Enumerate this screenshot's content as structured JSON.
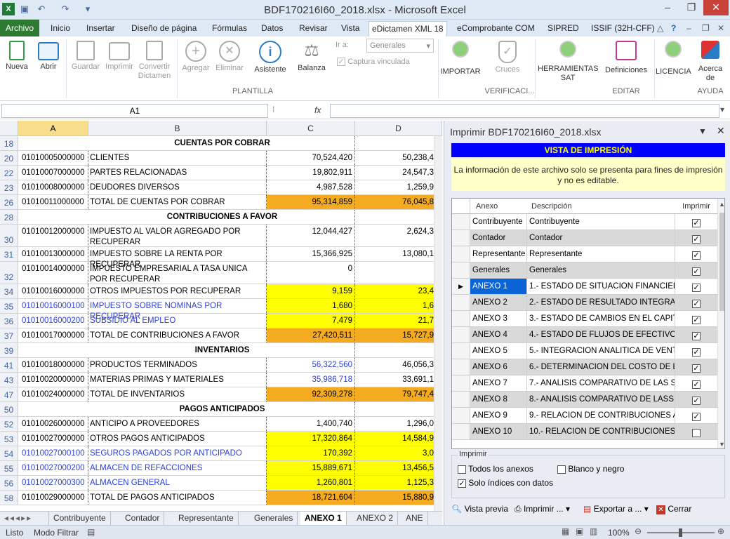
{
  "window": {
    "title": "BDF170216I60_2018.xlsx - Microsoft Excel"
  },
  "tabs": [
    "Archivo",
    "Inicio",
    "Insertar",
    "Diseño de página",
    "Fórmulas",
    "Datos",
    "Revisar",
    "Vista",
    "eDictamen XML 18",
    "eComprobante COM",
    "SIPRED",
    "ISSIF (32H-CFF)"
  ],
  "ribbon": {
    "buttons": [
      "Nueva",
      "Abrir",
      "Guardar",
      "Imprimir",
      "Convertir Dictamen",
      "Agregar",
      "Eliminar",
      "Asistente",
      "Balanza",
      "IMPORTAR",
      "Cruces",
      "HERRAMIENTAS SAT",
      "Definiciones",
      "LICENCIA",
      "Acerca de"
    ],
    "ir_a_label": "Ir a:",
    "ir_a_value": "Generales",
    "captura_label": "Captura vinculada",
    "groups": [
      "PLANTILLA",
      "VERIFICACI...",
      "EDITAR",
      "AYUDA"
    ]
  },
  "formula_bar": {
    "namebox": "A1",
    "fx": "fx"
  },
  "columns": [
    "A",
    "B",
    "C",
    "D"
  ],
  "rows": [
    {
      "n": "18",
      "type": "section",
      "b": "CUENTAS POR COBRAR"
    },
    {
      "n": "20",
      "a": "01010005000000",
      "b": "CLIENTES",
      "c": "70,524,420",
      "d": "50,238,4"
    },
    {
      "n": "22",
      "a": "01010007000000",
      "b": "PARTES RELACIONADAS",
      "c": "19,802,911",
      "d": "24,547,3"
    },
    {
      "n": "23",
      "a": "01010008000000",
      "b": "DEUDORES DIVERSOS",
      "c": "4,987,528",
      "d": "1,259,9"
    },
    {
      "n": "26",
      "a": "01010011000000",
      "b": "TOTAL DE CUENTAS POR COBRAR",
      "c": "95,314,859",
      "d": "76,045,8",
      "fill": "org"
    },
    {
      "n": "28",
      "type": "section",
      "b": "CONTRIBUCIONES A FAVOR"
    },
    {
      "n": "30",
      "a": "01010012000000",
      "b": "IMPUESTO AL VALOR AGREGADO POR RECUPERAR",
      "c": "12,044,427",
      "d": "2,624,3",
      "tall": true
    },
    {
      "n": "31",
      "a": "01010013000000",
      "b": "IMPUESTO SOBRE LA RENTA POR RECUPERAR",
      "c": "15,366,925",
      "d": "13,080,1"
    },
    {
      "n": "32",
      "a": "01010014000000",
      "b": "IMPUESTO EMPRESARIAL A TASA UNICA POR RECUPERAR",
      "c": "0",
      "d": "",
      "tall": true
    },
    {
      "n": "34",
      "a": "01010016000000",
      "b": "OTROS IMPUESTOS POR RECUPERAR",
      "c": "9,159",
      "d": "23,4",
      "fill": "yel"
    },
    {
      "n": "35",
      "a": "01010016000100",
      "b": "IMPUESTO SOBRE NOMINAS POR RECUPERAR",
      "c": "1,680",
      "d": "1,6",
      "fill": "yel",
      "blue": true
    },
    {
      "n": "36",
      "a": "01010016000200",
      "b": "SUBSIDIO AL EMPLEO",
      "c": "7,479",
      "d": "21,7",
      "fill": "yel",
      "blue": true
    },
    {
      "n": "37",
      "a": "01010017000000",
      "b": "TOTAL DE CONTRIBUCIONES A FAVOR",
      "c": "27,420,511",
      "d": "15,727,9",
      "fill": "org"
    },
    {
      "n": "39",
      "type": "section",
      "b": "INVENTARIOS"
    },
    {
      "n": "41",
      "a": "01010018000000",
      "b": "PRODUCTOS TERMINADOS",
      "c": "56,322,560",
      "d": "46,056,3",
      "cblue": true
    },
    {
      "n": "43",
      "a": "01010020000000",
      "b": "MATERIAS PRIMAS Y MATERIALES",
      "c": "35,986,718",
      "d": "33,691,1",
      "cblue": true
    },
    {
      "n": "47",
      "a": "01010024000000",
      "b": "TOTAL DE INVENTARIOS",
      "c": "92,309,278",
      "d": "79,747,4",
      "fill": "org"
    },
    {
      "n": "50",
      "type": "section",
      "b": "PAGOS ANTICIPADOS"
    },
    {
      "n": "52",
      "a": "01010026000000",
      "b": "ANTICIPO A PROVEEDORES",
      "c": "1,400,740",
      "d": "1,296,0"
    },
    {
      "n": "53",
      "a": "01010027000000",
      "b": "OTROS PAGOS ANTICIPADOS",
      "c": "17,320,864",
      "d": "14,584,9",
      "fill": "yel"
    },
    {
      "n": "54",
      "a": "01010027000100",
      "b": "SEGUROS PAGADOS POR ANTICIPADO",
      "c": "170,392",
      "d": "3,0",
      "fill": "yel",
      "blue": true
    },
    {
      "n": "55",
      "a": "01010027000200",
      "b": "ALMACEN DE REFACCIONES",
      "c": "15,889,671",
      "d": "13,456,5",
      "fill": "yel",
      "blue": true
    },
    {
      "n": "56",
      "a": "01010027000300",
      "b": "ALMACEN GENERAL",
      "c": "1,260,801",
      "d": "1,125,3",
      "fill": "yel",
      "blue": true
    },
    {
      "n": "58",
      "a": "01010029000000",
      "b": "TOTAL DE PAGOS ANTICIPADOS",
      "c": "18,721,604",
      "d": "15,880,9",
      "fill": "org"
    }
  ],
  "sheet_tabs": [
    "Contribuyente",
    "Contador",
    "Representante",
    "Generales",
    "ANEXO 1",
    "ANEXO 2",
    "ANE"
  ],
  "status": {
    "left": "Listo",
    "mode": "Modo Filtrar",
    "zoom": "100%"
  },
  "panel": {
    "title": "Imprimir BDF170216I60_2018.xlsx",
    "banner": "VISTA DE IMPRESIÓN",
    "info": "La información de este archivo solo se presenta para fines de impresión y no es editable.",
    "headers": {
      "anexo": "Anexo",
      "descripcion": "Descripción",
      "imprimir": "Imprimir"
    },
    "rows": [
      {
        "anexo": "Contribuyente",
        "desc": "Contribuyente",
        "checked": true,
        "w": true
      },
      {
        "anexo": "Contador",
        "desc": "Contador",
        "checked": true
      },
      {
        "anexo": "Representante",
        "desc": "Representante",
        "checked": true,
        "w": true
      },
      {
        "anexo": "Generales",
        "desc": "Generales",
        "checked": true
      },
      {
        "anexo": "ANEXO 1",
        "desc": "1.- ESTADO DE SITUACION FINANCIERA",
        "checked": true,
        "w": true,
        "sel": true
      },
      {
        "anexo": "ANEXO 2",
        "desc": "2.- ESTADO DE RESULTADO INTEGRAL",
        "checked": true
      },
      {
        "anexo": "ANEXO 3",
        "desc": "3.- ESTADO DE CAMBIOS EN EL CAPIT...",
        "checked": true,
        "w": true
      },
      {
        "anexo": "ANEXO 4",
        "desc": "4.- ESTADO DE FLUJOS DE EFECTIVO",
        "checked": true
      },
      {
        "anexo": "ANEXO 5",
        "desc": "5.- INTEGRACION ANALITICA DE VENT...",
        "checked": true,
        "w": true
      },
      {
        "anexo": "ANEXO 6",
        "desc": "6.- DETERMINACION DEL COSTO DE L...",
        "checked": true
      },
      {
        "anexo": "ANEXO 7",
        "desc": "7.- ANALISIS COMPARATIVO DE LAS S...",
        "checked": true,
        "w": true
      },
      {
        "anexo": "ANEXO 8",
        "desc": "8.- ANALISIS COMPARATIVO DE LASS...",
        "checked": true
      },
      {
        "anexo": "ANEXO 9",
        "desc": "9.- RELACION DE CONTRIBUCIONES A...",
        "checked": true,
        "w": true
      },
      {
        "anexo": "ANEXO 10",
        "desc": "10.- RELACION DE CONTRIBUCIONES ...",
        "checked": false
      }
    ],
    "options_label": "Imprimir",
    "opt_todos": "Todos los anexos",
    "opt_blanco": "Blanco y negro",
    "opt_solo": "Solo índices con datos",
    "btn_vista": "Vista previa",
    "btn_imprimir": "Imprimir ...",
    "btn_exportar": "Exportar a ...",
    "btn_cerrar": "Cerrar"
  }
}
